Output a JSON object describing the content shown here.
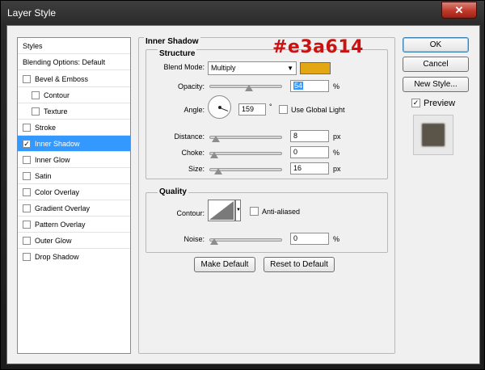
{
  "window": {
    "title": "Layer Style",
    "close_glyph": "✕"
  },
  "styles_panel": {
    "header": "Styles",
    "blending": "Blending Options: Default",
    "items": [
      {
        "label": "Bevel & Emboss",
        "checked": false
      },
      {
        "label": "Contour",
        "checked": false
      },
      {
        "label": "Texture",
        "checked": false
      },
      {
        "label": "Stroke",
        "checked": false
      },
      {
        "label": "Inner Shadow",
        "checked": true,
        "selected": true
      },
      {
        "label": "Inner Glow",
        "checked": false
      },
      {
        "label": "Satin",
        "checked": false
      },
      {
        "label": "Color Overlay",
        "checked": false
      },
      {
        "label": "Gradient Overlay",
        "checked": false
      },
      {
        "label": "Pattern Overlay",
        "checked": false
      },
      {
        "label": "Outer Glow",
        "checked": false
      },
      {
        "label": "Drop Shadow",
        "checked": false
      }
    ],
    "check_glyph": "✓"
  },
  "inner_shadow": {
    "title": "Inner Shadow",
    "structure": {
      "title": "Structure",
      "blend_mode_label": "Blend Mode:",
      "blend_mode": "Multiply",
      "color": "#e3a614",
      "opacity_label": "Opacity:",
      "opacity": "54",
      "opacity_unit": "%",
      "angle_label": "Angle:",
      "angle": "159",
      "angle_unit": "°",
      "global_light_label": "Use Global Light",
      "distance_label": "Distance:",
      "distance": "8",
      "distance_unit": "px",
      "choke_label": "Choke:",
      "choke": "0",
      "choke_unit": "%",
      "size_label": "Size:",
      "size": "16",
      "size_unit": "px"
    },
    "quality": {
      "title": "Quality",
      "contour_label": "Contour:",
      "anti_aliased_label": "Anti-aliased",
      "noise_label": "Noise:",
      "noise": "0",
      "noise_unit": "%"
    },
    "make_default": "Make Default",
    "reset_default": "Reset to Default"
  },
  "annotation": "#e3a614",
  "buttons": {
    "ok": "OK",
    "cancel": "Cancel",
    "new_style": "New Style...",
    "preview_label": "Preview",
    "preview_checked": true
  },
  "sliders": {
    "opacity_fraction": 0.54,
    "distance_fraction": 0.03,
    "choke_fraction": 0.0,
    "size_fraction": 0.06,
    "noise_fraction": 0.0
  },
  "dropdown_glyph": "▼"
}
